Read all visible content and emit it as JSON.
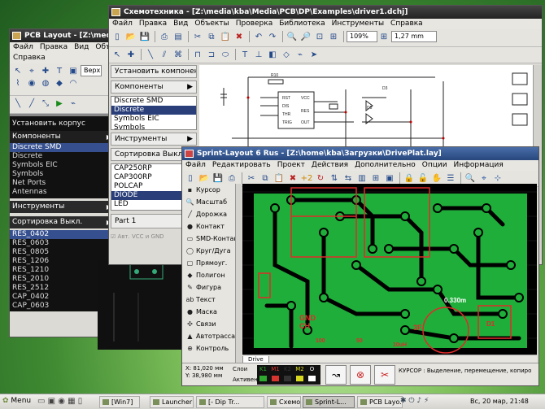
{
  "pcb_layout": {
    "title": "PCB Layout - [Z:\\media\\k",
    "menu": [
      "Файл",
      "Правка",
      "Вид",
      "Объекты"
    ],
    "menu2": [
      "Справка"
    ],
    "combo_value": "Верх",
    "install_label": "Установить корпус",
    "components_label": "Компоненты",
    "components_list": [
      "Discrete SMD",
      "Discrete",
      "Symbols EIC",
      "Symbols",
      "Net Ports",
      "Antennas"
    ],
    "components_selected": 0,
    "tools_label": "Инструменты",
    "sort_label": "Сортировка Выкл.",
    "parts_list": [
      "RES_0402",
      "RES_0603",
      "RES_0805",
      "RES_1206",
      "RES_1210",
      "RES_2010",
      "RES_2512",
      "CAP_0402",
      "CAP_0603"
    ]
  },
  "schematic": {
    "title": "Схемотехника - [Z:\\media\\kba\\Media\\PCB\\DP\\Examples\\driver1.dchj]",
    "menu": [
      "Файл",
      "Правка",
      "Вид",
      "Объекты",
      "Проверка",
      "Библиотека",
      "Инструменты",
      "Справка"
    ],
    "zoom_value": "109%",
    "grid_value": "1,27 mm",
    "install_label": "Установить компонент",
    "components_label": "Компоненты",
    "components_list": [
      "Discrete SMD",
      "Discrete",
      "Symbols EIC",
      "Symbols"
    ],
    "components_selected": 1,
    "tools_label": "Инструменты",
    "sort_label": "Сортировка Выкл.",
    "parts_list": [
      "CAP250RP",
      "CAP300RP",
      "POLCAP",
      "DIODE",
      "LED"
    ],
    "parts_selected": 3,
    "part_label": "Part 1",
    "auto_vcc_label": "Авт. VCC и GND"
  },
  "sprint": {
    "title": "Sprint-Layout 6 Rus - [Z:\\home\\kba\\Загрузки\\DrivePlat.lay]",
    "menu": [
      "Файл",
      "Редактировать",
      "Проект",
      "Действия",
      "Дополнительно",
      "Опции",
      "Информация"
    ],
    "tools": [
      {
        "icon": "▪",
        "label": "Курсор"
      },
      {
        "icon": "🔍",
        "label": "Масштаб"
      },
      {
        "icon": "╱",
        "label": "Дорожка"
      },
      {
        "icon": "●",
        "label": "Контакт"
      },
      {
        "icon": "▭",
        "label": "SMD-Контакт"
      },
      {
        "icon": "◯",
        "label": "Круг/Дуга"
      },
      {
        "icon": "▢",
        "label": "Прямоуг."
      },
      {
        "icon": "◆",
        "label": "Полигон"
      },
      {
        "icon": "✎",
        "label": "Фигура"
      },
      {
        "icon": "ab",
        "label": "Текст"
      },
      {
        "icon": "●",
        "label": "Маска"
      },
      {
        "icon": "✣",
        "label": "Связи"
      },
      {
        "icon": "▲",
        "label": "Автотрасса"
      },
      {
        "icon": "⊕",
        "label": "Контроль"
      }
    ],
    "tab_label": "Drive",
    "x_label": "X:",
    "x_value": "81,020 мм",
    "y_label": "Y:",
    "y_value": "38,980 мм",
    "layers_label": "Слои",
    "active_label": "Активен",
    "layer_names": [
      "K1",
      "M1",
      "K2",
      "M2",
      "O"
    ],
    "layer_colors": [
      "#2ea82e",
      "#d6342e",
      "#333333",
      "#d8d820",
      "#ffffff"
    ],
    "status_text": "КУРСОР : Выделение, перемещение, копиро",
    "board_labels": [
      "GND",
      "CH",
      "3F",
      "0.330m",
      "D1",
      "10uH",
      "50",
      "100"
    ]
  },
  "taskbar": {
    "menu_label": "Menu",
    "tasks": [
      "[Win7]",
      "Launcher",
      "[- Dip Tr...",
      "Схемот...",
      "Sprint-L...",
      "PCB Layo...",
      ""
    ],
    "active_task": 4,
    "clock": "Вс, 20 мар, 21:48"
  }
}
